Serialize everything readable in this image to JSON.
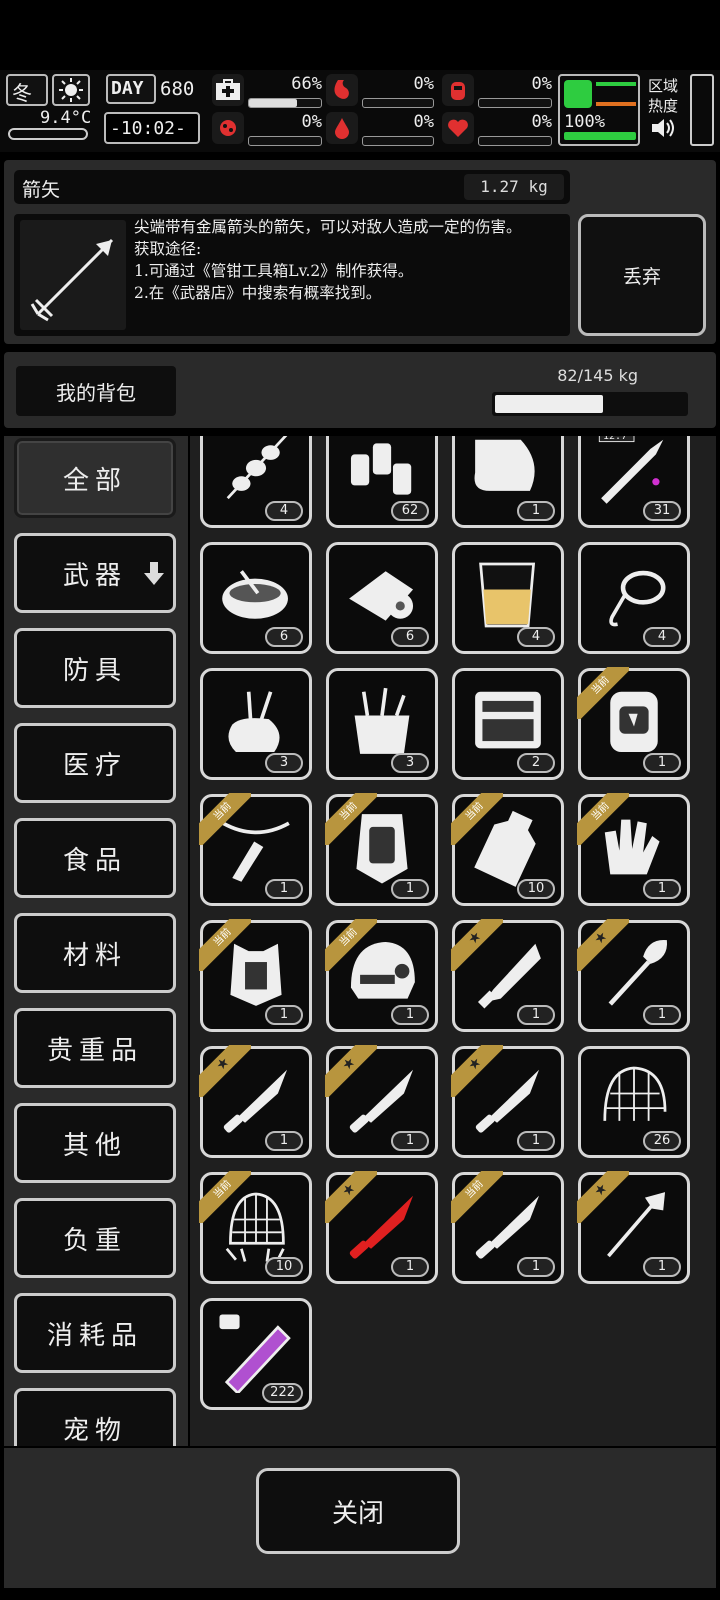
{
  "hud": {
    "season": "冬",
    "temperature": "9.4°C",
    "day_label": "DAY",
    "day": "680",
    "clock": "-10:02-",
    "zone_label": "区域\n热度",
    "stats": [
      {
        "name": "health",
        "pct": "66%",
        "fill": 0.66,
        "color": "#e03030"
      },
      {
        "name": "hunger",
        "pct": "0%",
        "fill": 0,
        "color": "#e03030"
      },
      {
        "name": "thirst",
        "pct": "0%",
        "fill": 0,
        "color": "#e03030"
      },
      {
        "name": "infection",
        "pct": "0%",
        "fill": 0,
        "color": "#e03030"
      },
      {
        "name": "bleeding",
        "pct": "0%",
        "fill": 0,
        "color": "#e03030"
      },
      {
        "name": "mood",
        "pct": "0%",
        "fill": 0,
        "color": "#e03030"
      },
      {
        "name": "stamina",
        "pct": "100%",
        "fill": 1.0,
        "color": "#2ecc40"
      }
    ]
  },
  "detail": {
    "item_name": "箭矢",
    "weight": "1.27 kg",
    "description": "尖端带有金属箭头的箭矢，可以对敌人造成一定的伤害。\n获取途径:\n1.可通过《管钳工具箱Lv.2》制作获得。\n2.在《武器店》中搜索有概率找到。",
    "drop_label": "丢弃"
  },
  "bag": {
    "label": "我的背包",
    "capacity": "82/145 kg",
    "fill": 0.566
  },
  "categories": [
    {
      "label": "全部",
      "active": true
    },
    {
      "label": "武器",
      "active": false,
      "arrow": true
    },
    {
      "label": "防具",
      "active": false
    },
    {
      "label": "医疗",
      "active": false
    },
    {
      "label": "食品",
      "active": false
    },
    {
      "label": "材料",
      "active": false
    },
    {
      "label": "贵重品",
      "active": false
    },
    {
      "label": "其他",
      "active": false
    },
    {
      "label": "负重",
      "active": false
    },
    {
      "label": "消耗品",
      "active": false
    },
    {
      "label": "宠物",
      "active": false
    }
  ],
  "items": [
    {
      "icon": "skewer-icon",
      "count": "4",
      "badge": ""
    },
    {
      "icon": "bottles-icon",
      "count": "62",
      "badge": ""
    },
    {
      "icon": "cloth-icon",
      "count": "1",
      "badge": ""
    },
    {
      "icon": "bullet-icon",
      "count": "31",
      "badge": "",
      "tag": "12.7"
    },
    {
      "icon": "soup-bowl-icon",
      "count": "6",
      "badge": ""
    },
    {
      "icon": "bandage-icon",
      "count": "6",
      "badge": ""
    },
    {
      "icon": "juice-cup-icon",
      "count": "4",
      "badge": ""
    },
    {
      "icon": "rope-hook-icon",
      "count": "4",
      "badge": ""
    },
    {
      "icon": "tool-bag-icon",
      "count": "3",
      "badge": ""
    },
    {
      "icon": "toolbox-icon",
      "count": "3",
      "badge": ""
    },
    {
      "icon": "wrench-case-icon",
      "count": "2",
      "badge": ""
    },
    {
      "icon": "backpack-icon",
      "count": "1",
      "badge": "当前"
    },
    {
      "icon": "crossbow-icon",
      "count": "1",
      "badge": "当前"
    },
    {
      "icon": "armor-plate-icon",
      "count": "1",
      "badge": "当前"
    },
    {
      "icon": "canteen-icon",
      "count": "10",
      "badge": "当前"
    },
    {
      "icon": "gloves-icon",
      "count": "1",
      "badge": "当前"
    },
    {
      "icon": "vest-icon",
      "count": "1",
      "badge": "当前"
    },
    {
      "icon": "helmet-icon",
      "count": "1",
      "badge": "当前"
    },
    {
      "icon": "machete-icon",
      "count": "1",
      "badge": "star"
    },
    {
      "icon": "shovel-icon",
      "count": "1",
      "badge": "star"
    },
    {
      "icon": "knife-icon",
      "count": "1",
      "badge": "star"
    },
    {
      "icon": "knife-icon",
      "count": "1",
      "badge": "star"
    },
    {
      "icon": "knife-icon",
      "count": "1",
      "badge": "star"
    },
    {
      "icon": "net-icon",
      "count": "26",
      "badge": ""
    },
    {
      "icon": "trap-net-icon",
      "count": "10",
      "badge": "当前"
    },
    {
      "icon": "red-knife-icon",
      "count": "1",
      "badge": "star"
    },
    {
      "icon": "knife-icon",
      "count": "1",
      "badge": "当前"
    },
    {
      "icon": "axe-icon",
      "count": "1",
      "badge": "star"
    },
    {
      "icon": "syringe-icon",
      "count": "222",
      "badge": ""
    }
  ],
  "footer": {
    "close_label": "关闭"
  },
  "colors": {
    "ribbon": "#b8953e",
    "panel": "#2a2a2a",
    "health_red": "#e03030",
    "stamina_green": "#2ecc40"
  }
}
